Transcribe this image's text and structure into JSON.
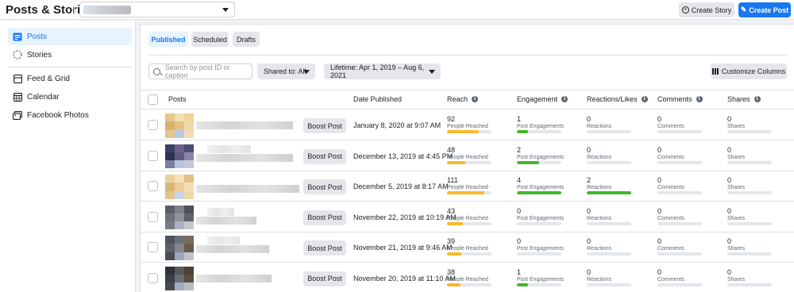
{
  "topbar": {
    "title": "Posts & Stories",
    "create_story_label": "Create Story",
    "create_post_label": "Create Post"
  },
  "sidebar": {
    "items": [
      {
        "label": "Posts",
        "icon": "posts-icon",
        "active": true
      },
      {
        "label": "Stories",
        "icon": "stories-icon",
        "active": false
      },
      {
        "label": "Feed & Grid",
        "icon": "feed-grid-icon",
        "active": false
      },
      {
        "label": "Calendar",
        "icon": "calendar-icon",
        "active": false
      },
      {
        "label": "Facebook Photos",
        "icon": "photos-icon",
        "active": false
      }
    ]
  },
  "tabs": [
    {
      "label": "Published",
      "active": true
    },
    {
      "label": "Scheduled",
      "active": false
    },
    {
      "label": "Drafts",
      "active": false
    }
  ],
  "filters": {
    "search_placeholder": "Search by post ID or caption",
    "shared_to": "Shared to: All",
    "date_range": "Lifetime: Apr 1, 2019 – Aug 6, 2021",
    "customize_label": "Customize Columns"
  },
  "columns": [
    "Posts",
    "Date Published",
    "Reach",
    "Engagement",
    "Reactions/Likes",
    "Comments",
    "Shares"
  ],
  "boost_label": "Boost Post",
  "colors": {
    "accent": "#1877f2",
    "reach_bar": "#f7b928",
    "engagement_bar": "#42b72a",
    "reactions_bar": "#42b72a"
  },
  "rows": [
    {
      "date": "January 8, 2020 at 9:07 AM",
      "reach": "92",
      "reach_label": "People Reached",
      "reach_fill": 0.72,
      "engagement": "1",
      "engagement_label": "Post Engagements",
      "engagement_fill": 0.25,
      "reactions": "0",
      "reactions_label": "Reactions",
      "reactions_fill": 0,
      "comments": "0",
      "comments_label": "Comments",
      "shares": "0",
      "shares_label": "Shares"
    },
    {
      "date": "December 13, 2019 at 4:45 PM",
      "reach": "48",
      "reach_label": "People Reached",
      "reach_fill": 0.41,
      "engagement": "2",
      "engagement_label": "Post Engagements",
      "engagement_fill": 0.5,
      "reactions": "0",
      "reactions_label": "Reactions",
      "reactions_fill": 0,
      "comments": "0",
      "comments_label": "Comments",
      "shares": "0",
      "shares_label": "Shares"
    },
    {
      "date": "December 5, 2019 at 8:17 AM",
      "reach": "111",
      "reach_label": "People Reached",
      "reach_fill": 0.84,
      "engagement": "4",
      "engagement_label": "Post Engagements",
      "engagement_fill": 1.0,
      "reactions": "2",
      "reactions_label": "Reactions",
      "reactions_fill": 1.0,
      "comments": "0",
      "comments_label": "Comments",
      "shares": "0",
      "shares_label": "Shares"
    },
    {
      "date": "November 22, 2019 at 10:19 AM",
      "reach": "43",
      "reach_label": "People Reached",
      "reach_fill": 0.36,
      "engagement": "0",
      "engagement_label": "Post Engagements",
      "engagement_fill": 0,
      "reactions": "0",
      "reactions_label": "Reactions",
      "reactions_fill": 0,
      "comments": "0",
      "comments_label": "Comments",
      "shares": "0",
      "shares_label": "Shares"
    },
    {
      "date": "November 21, 2019 at 9:46 AM",
      "reach": "39",
      "reach_label": "People Reached",
      "reach_fill": 0.32,
      "engagement": "0",
      "engagement_label": "Post Engagements",
      "engagement_fill": 0,
      "reactions": "0",
      "reactions_label": "Reactions",
      "reactions_fill": 0,
      "comments": "0",
      "comments_label": "Comments",
      "shares": "0",
      "shares_label": "Shares"
    },
    {
      "date": "November 20, 2019 at 11:10 AM",
      "reach": "38",
      "reach_label": "People Reached",
      "reach_fill": 0.31,
      "engagement": "1",
      "engagement_label": "Post Engagements",
      "engagement_fill": 0.25,
      "reactions": "0",
      "reactions_label": "Reactions",
      "reactions_fill": 0,
      "comments": "0",
      "comments_label": "Comments",
      "shares": "0",
      "shares_label": "Shares"
    }
  ]
}
